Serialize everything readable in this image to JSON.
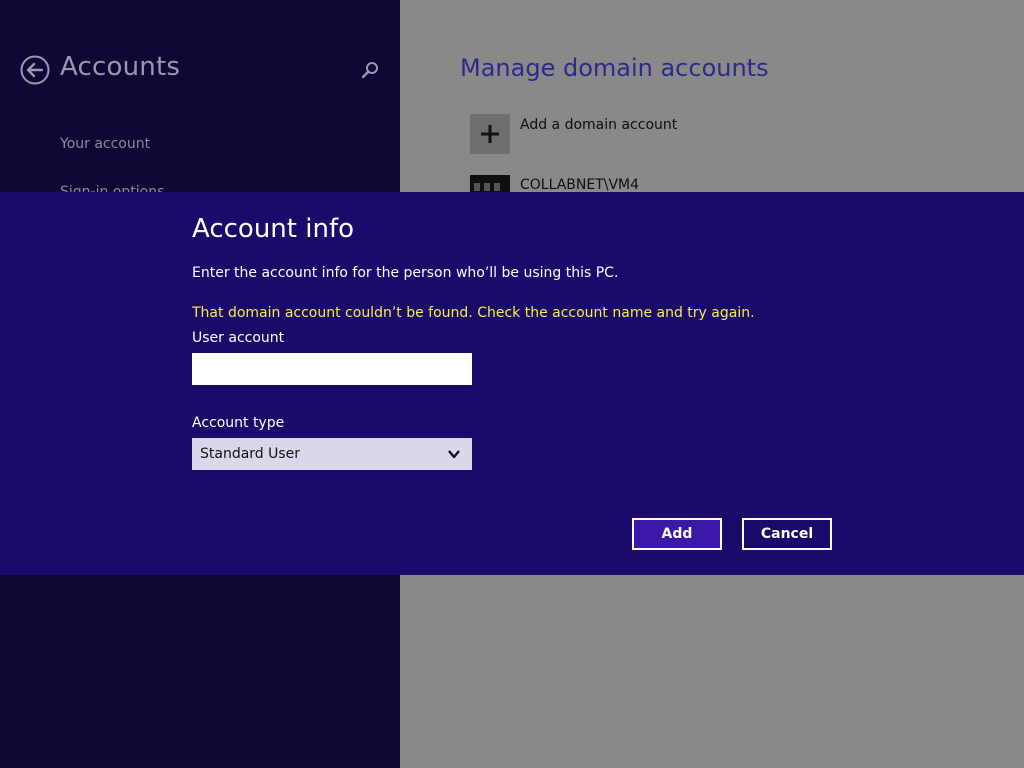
{
  "left_pane": {
    "title": "Accounts",
    "back_icon": "back-arrow-icon",
    "search_icon": "search-icon",
    "nav_items": [
      "Your account",
      "Sign-in options"
    ]
  },
  "right_pane": {
    "title": "Manage domain accounts",
    "add_label": "Add a domain account",
    "account_name": "COLLABNET\\VM4"
  },
  "dialog": {
    "title": "Account info",
    "subtitle": "Enter the account info for the person who’ll be using this PC.",
    "error": "That domain account couldn’t be found. Check the account name and try again.",
    "user_account_label": "User account",
    "user_account_value": "",
    "account_type_label": "Account type",
    "account_type_value": "Standard User",
    "add_button": "Add",
    "cancel_button": "Cancel"
  },
  "colors": {
    "dialog_bg": "#1c0a6b",
    "error_text": "#f1ef4e",
    "left_pane_bg": "#0f0735",
    "overlay_gray": "#898989"
  }
}
